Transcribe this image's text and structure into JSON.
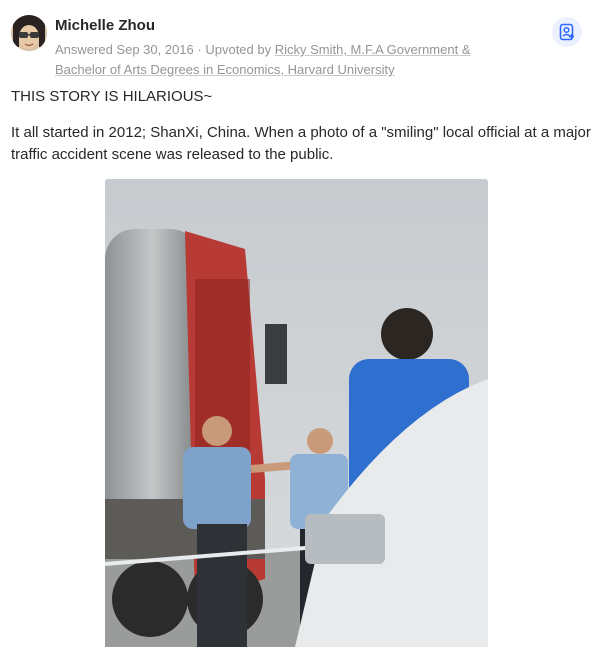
{
  "author": {
    "name": "Michelle Zhou"
  },
  "meta": {
    "answered": "Answered Sep 30, 2016",
    "separator": " · ",
    "upvoted_prefix": "Upvoted by ",
    "upvoter": "Ricky Smith, M.F.A Government & Bachelor of Arts Degrees in Economics, Harvard University"
  },
  "follow_icon": "person-add-icon",
  "content": {
    "paragraph1": "THIS STORY IS HILARIOUS~",
    "paragraph2": "It all started in 2012; ShanXi, China. When a photo of a \"smiling\" local official at a major traffic accident scene was released to the public."
  },
  "colors": {
    "accent": "#2e69ff",
    "accent_bg": "#ebf0ff",
    "meta_text": "#939598",
    "body_text": "#282829"
  }
}
